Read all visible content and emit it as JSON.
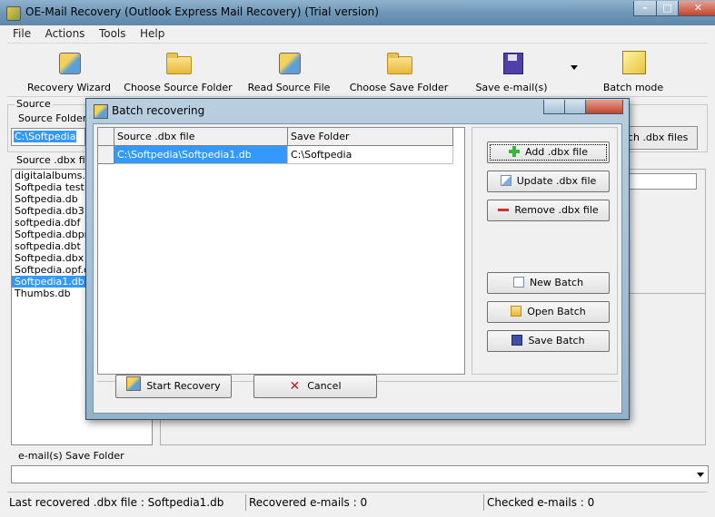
{
  "window": {
    "title": "OE-Mail Recovery (Outlook Express Mail Recovery) (Trial version)",
    "controls": {
      "minimize": "–",
      "maximize": "□",
      "close": "✕"
    }
  },
  "menu": [
    "File",
    "Actions",
    "Tools",
    "Help"
  ],
  "toolbar": {
    "recovery_wizard": "Recovery Wizard",
    "choose_source_folder": "Choose Source Folder",
    "read_source_file": "Read Source File",
    "choose_save_folder": "Choose Save Folder",
    "save_emails": "Save e-mail(s)",
    "batch_mode": "Batch mode"
  },
  "source": {
    "group_label": "Source",
    "folder_label": "Source Folder",
    "folder_value": "C:\\Softpedia",
    "search_button": "rch .dbx files",
    "dbx_label": "Source .dbx file",
    "dbx_files": [
      "digitalalbums.db",
      "Softpedia test.db",
      "Softpedia.db",
      "Softpedia.db3",
      "softpedia.dbf",
      "Softpedia.dbproj",
      "softpedia.dbt",
      "Softpedia.dbx",
      "Softpedia.opf.db",
      "Softpedia1.db",
      "Thumbs.db"
    ],
    "selected_file": "Softpedia1.db"
  },
  "save_folder": {
    "label": "e-mail(s) Save Folder",
    "value": ""
  },
  "status": {
    "last_recovered": "Last recovered .dbx file : Softpedia1.db",
    "recovered": "Recovered e-mails : 0",
    "checked": "Checked e-mails : 0"
  },
  "dialog": {
    "title": "Batch recovering",
    "columns": [
      "Source .dbx file",
      "Save Folder"
    ],
    "rows": [
      {
        "source": "C:\\Softpedia\\Softpedia1.db",
        "save": "C:\\Softpedia"
      }
    ],
    "buttons": {
      "add": "Add .dbx file",
      "update": "Update .dbx file",
      "remove": "Remove .dbx file",
      "new_batch": "New Batch",
      "open_batch": "Open Batch",
      "save_batch": "Save Batch",
      "start": "Start Recovery",
      "cancel": "Cancel"
    }
  }
}
